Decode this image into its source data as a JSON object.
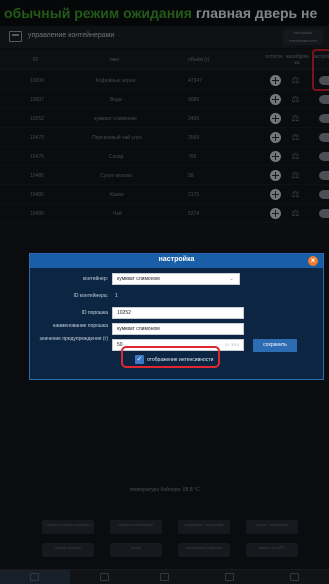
{
  "banner": {
    "part1": "обычный режим ожидания",
    "part2": "главная дверь не"
  },
  "subheader": {
    "title": "управление контейнерами",
    "button": "настройка интенсивности"
  },
  "table": {
    "columns": [
      "ID",
      "имя",
      "объём (г)",
      "остаток",
      "калибров-ка",
      "настройка"
    ],
    "rows": [
      {
        "id": "10000",
        "name": "Кофейные зерна",
        "volume": "47347"
      },
      {
        "id": "10007",
        "name": "Вода",
        "volume": "9089"
      },
      {
        "id": "10252",
        "name": "кумкват слимоном",
        "volume": "2405"
      },
      {
        "id": "10470",
        "name": "Персиковый чай улун",
        "volume": "3569"
      },
      {
        "id": "10476",
        "name": "Сахар",
        "volume": "765"
      },
      {
        "id": "10480",
        "name": "Сухое молоко",
        "volume": "58"
      },
      {
        "id": "10486",
        "name": "Какао",
        "volume": "2175"
      },
      {
        "id": "10490",
        "name": "Чай",
        "volume": "5274"
      }
    ]
  },
  "footer": {
    "status": "температура бойлера: 88.8 °C",
    "buttons": [
      "открыть дверь корзины",
      "открыть контейнер",
      "кофейные настройки",
      "статус терминала",
      "обзор ошибок",
      "меню",
      "настройки рецептов",
      "выйти из APP"
    ]
  },
  "modal": {
    "title": "настройка",
    "container_label": "контейнер:",
    "container_value": "кумкват слимоном",
    "id_label": "ID контейнера:",
    "id_value": "1",
    "powder_id_label": "ID порошка",
    "powder_id_value": "10252",
    "powder_name_label": "наименование порошка",
    "powder_name_value": "кумкват слимоном",
    "warning_label": "значение предупреждения (г)",
    "warning_value": "50",
    "warning_hint": "(0~300)",
    "save_label": "сохранить",
    "checkbox_label": "отображение интенсивности",
    "checkbox_checked": true
  },
  "colors": {
    "banner_green": "#3fa52c",
    "modal_header": "#1b5ea8",
    "highlight_red": "#e0262e",
    "close_orange": "#f07a2d"
  }
}
